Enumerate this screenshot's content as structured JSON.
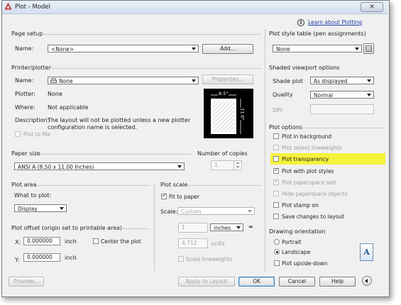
{
  "window": {
    "title": "Plot - Model",
    "close_glyph": "✕",
    "help_link": "Learn about Plotting"
  },
  "page_setup": {
    "heading": "Page setup",
    "name_label": "Name:",
    "name_value": "<None>",
    "add_button": "Add..."
  },
  "printer": {
    "heading": "Printer/plotter",
    "name_label": "Name:",
    "name_value": "None",
    "properties_button": "Properties...",
    "plotter_label": "Plotter:",
    "plotter_value": "None",
    "where_label": "Where:",
    "where_value": "Not applicable",
    "description_label": "Description:",
    "description_line1": "The layout will not be plotted unless a new plotter",
    "description_line2": "configuration name is selected.",
    "plot_to_file": "Plot to file",
    "preview_width": "8.5\"",
    "preview_height": "11.0\""
  },
  "paper_size": {
    "heading": "Paper size",
    "value": "ANSI A (8.50 x 11.00 Inches)"
  },
  "copies": {
    "heading": "Number of copies",
    "value": "1"
  },
  "plot_area": {
    "heading": "Plot area",
    "what_label": "What to plot:",
    "what_value": "Display"
  },
  "plot_scale": {
    "heading": "Plot scale",
    "fit_to_paper": "Fit to paper",
    "fit_checked": true,
    "scale_label": "Scale:",
    "scale_value": "Custom",
    "num_value": "1",
    "unit_value": "inches",
    "equals": "=",
    "units_value": "4.712",
    "units_label": "units",
    "scale_lineweights": "Scale lineweights"
  },
  "plot_offset": {
    "heading": "Plot offset (origin set to printable area)",
    "x_label": "X:",
    "x_value": "0.000000",
    "x_unit": "inch",
    "y_label": "Y:",
    "y_value": "0.000000",
    "y_unit": "inch",
    "center_plot": "Center the plot"
  },
  "plot_style_table": {
    "heading": "Plot style table (pen assignments)",
    "value": "None"
  },
  "shaded_viewport": {
    "heading": "Shaded viewport options",
    "shade_label": "Shade plot",
    "shade_value": "As displayed",
    "quality_label": "Quality",
    "quality_value": "Normal",
    "dpi_label": "DPI"
  },
  "plot_options": {
    "heading": "Plot options",
    "items": [
      {
        "label": "Plot in background",
        "checked": false,
        "disabled": false
      },
      {
        "label": "Plot object lineweights",
        "checked": false,
        "disabled": true
      },
      {
        "label": "Plot transparency",
        "checked": false,
        "disabled": false
      },
      {
        "label": "Plot with plot styles",
        "checked": true,
        "disabled": false
      },
      {
        "label": "Plot paperspace last",
        "checked": true,
        "disabled": true
      },
      {
        "label": "Hide paperspace objects",
        "checked": false,
        "disabled": true
      },
      {
        "label": "Plot stamp on",
        "checked": false,
        "disabled": false
      },
      {
        "label": "Save changes to layout",
        "checked": false,
        "disabled": false
      }
    ],
    "highlight_color": "#f5f23c"
  },
  "drawing_orientation": {
    "heading": "Drawing orientation",
    "portrait": "Portrait",
    "landscape": "Landscape",
    "selected": "Landscape",
    "upside_down": "Plot upside-down",
    "preview_letter": "A"
  },
  "footer": {
    "preview": "Preview...",
    "apply_to_layout": "Apply to Layout",
    "ok": "OK",
    "cancel": "Cancel",
    "help": "Help"
  }
}
